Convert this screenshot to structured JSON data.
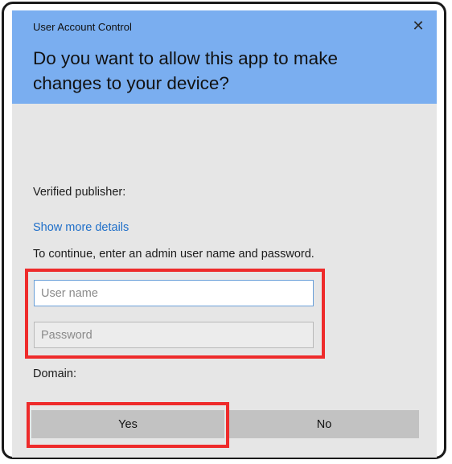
{
  "window": {
    "title": "User Account Control",
    "close_glyph": "✕",
    "close_icon": "close-icon"
  },
  "dialog": {
    "heading": "Do you want to allow this app to make changes to your device?",
    "publisher_label": "Verified publisher:",
    "details_link": "Show more details",
    "instruction": "To continue, enter an admin user name and password.",
    "username_placeholder": "User name",
    "username_value": "",
    "password_placeholder": "Password",
    "password_value": "",
    "domain_label": "Domain:"
  },
  "buttons": {
    "yes_label": "Yes",
    "no_label": "No"
  },
  "colors": {
    "header": "#7aaef0",
    "body": "#e6e6e6",
    "link": "#1f6fc9",
    "highlight": "#ee2b2b",
    "button": "#c2c2c2"
  }
}
